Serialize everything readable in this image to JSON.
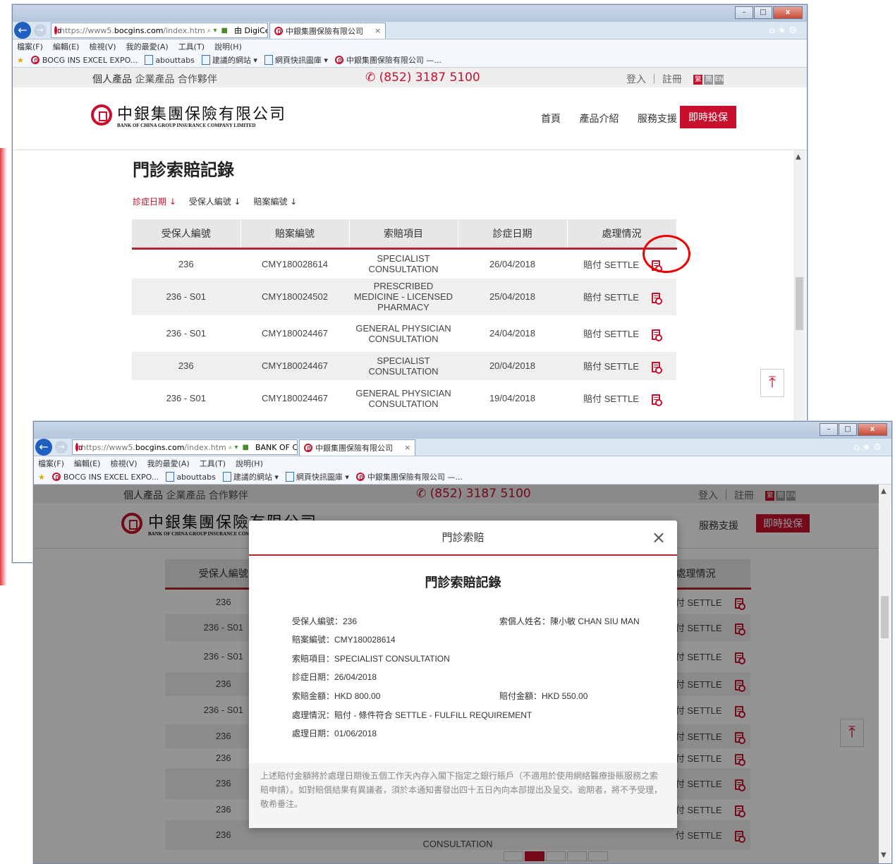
{
  "browser": {
    "url_prefix": "https://www5.",
    "url_host": "bocgins.com",
    "url_path": "/index.htm",
    "cert_label_1": "由 DigiCert 識別",
    "cert_label_2": "BANK OF CHI...",
    "tab_title": "中銀集團保險有限公司",
    "menu": [
      "檔案(F)",
      "編輯(E)",
      "檢視(V)",
      "我的最愛(A)",
      "工具(T)",
      "說明(H)"
    ],
    "favorites": [
      "BOCG INS EXCEL EXPO...",
      "abouttabs",
      "建議的網站 ▾",
      "網頁快訊圖庫 ▾",
      "中銀集團保險有限公司 —..."
    ]
  },
  "site": {
    "categories": [
      "個人產品",
      "企業產品",
      "合作夥伴"
    ],
    "phone": "(852) 3187 5100",
    "login": "登入",
    "register": "註冊",
    "lang": [
      "繁",
      "簡",
      "EN"
    ],
    "logo_cn": "中銀集團保險有限公司",
    "logo_en": "BANK OF CHINA GROUP INSURANCE COMPANY LIMITED",
    "nav": [
      "首頁",
      "產品介紹",
      "服務支援"
    ],
    "buy_now": "即時投保"
  },
  "page": {
    "title": "門診索賠記錄",
    "sort": [
      "診症日期",
      "受保人編號",
      "賠案編號"
    ]
  },
  "table": {
    "headers": [
      "受保人編號",
      "賠案編號",
      "索賠項目",
      "診症日期",
      "處理情況"
    ],
    "rows": [
      [
        "236",
        "CMY180028614",
        "SPECIALIST CONSULTATION",
        "26/04/2018",
        "賠付 SETTLE"
      ],
      [
        "236 - S01",
        "CMY180024502",
        "PRESCRIBED MEDICINE - LICENSED PHARMACY",
        "25/04/2018",
        "賠付 SETTLE"
      ],
      [
        "236 - S01",
        "CMY180024467",
        "GENERAL PHYSICIAN CONSULTATION",
        "24/04/2018",
        "賠付 SETTLE"
      ],
      [
        "236",
        "CMY180024467",
        "SPECIALIST CONSULTATION",
        "20/04/2018",
        "賠付 SETTLE"
      ],
      [
        "236 - S01",
        "CMY180024467",
        "GENERAL PHYSICIAN CONSULTATION",
        "19/04/2018",
        "賠付 SETTLE"
      ]
    ]
  },
  "bg_table": {
    "header_first": "受保人編號",
    "header_last": "處理情況",
    "rows": [
      "236",
      "236 - S01",
      "236 - S01",
      "236",
      "236 - S01",
      "236",
      "236",
      "236",
      "236",
      "236"
    ],
    "status": "付 SETTLE",
    "last_row_item": "CONSULTATION"
  },
  "modal": {
    "header": "門診索賠",
    "title": "門診索賠記錄",
    "insured_no": "受保人編號：236",
    "claimant": "索償人姓名：陳小敏 CHAN SIU MAN",
    "claim_no": "賠案編號：CMY180028614",
    "item": "索賠項目：SPECIALIST CONSULTATION",
    "visit_date": "診症日期：26/04/2018",
    "claim_amount": "索賠金額：HKD 800.00",
    "paid_amount": "賠付金額：HKD 550.00",
    "status": "處理情況：賠付 - 條件符合 SETTLE - FULFILL REQUIREMENT",
    "process_date": "處理日期：01/06/2018",
    "note": "上述賠付金額將於處理日期後五個工作天內存入閣下指定之銀行賬戶（不適用於使用網絡醫療掛賬服務之索賠申請）。如對賠償結果有異議者，須於本通知書發出四十五日內向本部提出及呈交。逾期者，將不予受理，敬希垂注。"
  }
}
